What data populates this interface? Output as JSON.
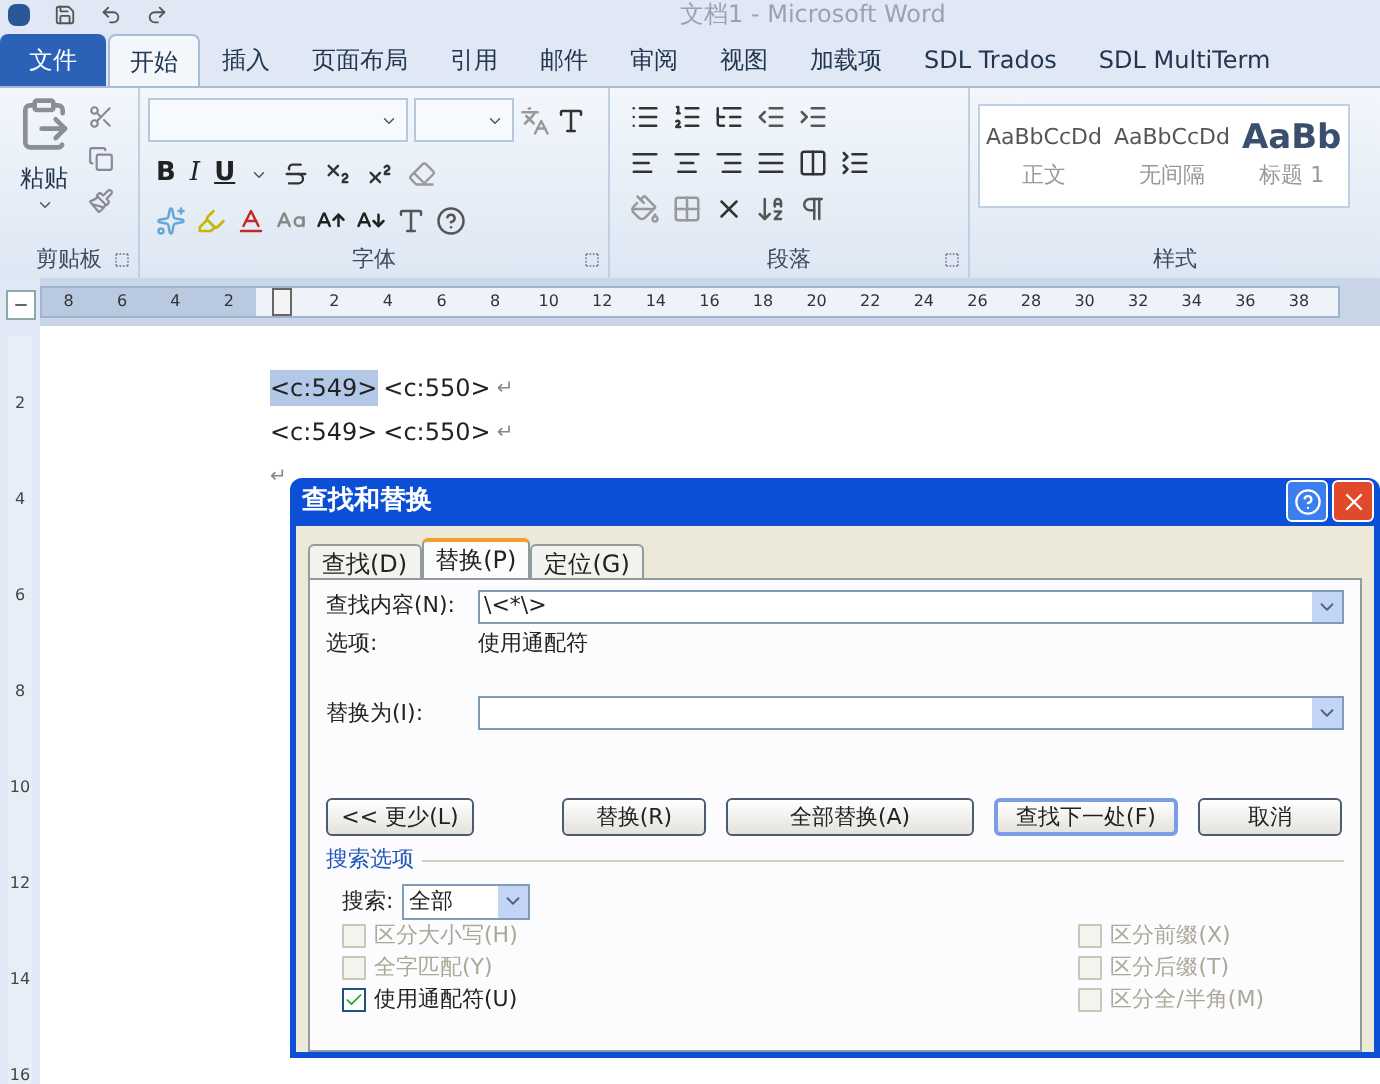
{
  "window": {
    "title": "文档1 - Microsoft Word"
  },
  "ribbon_tabs": [
    {
      "label": "文件",
      "kind": "file",
      "selected": false
    },
    {
      "label": "开始",
      "kind": "tab",
      "selected": true
    },
    {
      "label": "插入",
      "kind": "tab",
      "selected": false
    },
    {
      "label": "页面布局",
      "kind": "tab",
      "selected": false
    },
    {
      "label": "引用",
      "kind": "tab",
      "selected": false
    },
    {
      "label": "邮件",
      "kind": "tab",
      "selected": false
    },
    {
      "label": "审阅",
      "kind": "tab",
      "selected": false
    },
    {
      "label": "视图",
      "kind": "tab",
      "selected": false
    },
    {
      "label": "加载项",
      "kind": "tab",
      "selected": false
    },
    {
      "label": "SDL Trados",
      "kind": "tab",
      "selected": false
    },
    {
      "label": "SDL MultiTerm",
      "kind": "tab",
      "selected": false
    }
  ],
  "clipboard_group": {
    "title": "剪贴板",
    "paste_label": "粘贴"
  },
  "font_group": {
    "title": "字体",
    "bold": "B",
    "italic": "I",
    "underline": "U"
  },
  "paragraph_group": {
    "title": "段落"
  },
  "styles_group": {
    "title": "样式",
    "styles": [
      {
        "sample": "AaBbCcDd",
        "name": "正文",
        "kind": "normal"
      },
      {
        "sample": "AaBbCcDd",
        "name": "无间隔",
        "kind": "normal"
      },
      {
        "sample": "AaBb",
        "name": "标题 1",
        "kind": "heading"
      }
    ]
  },
  "ruler": {
    "left_ticks": [
      "8",
      "6",
      "4",
      "2"
    ],
    "ticks": [
      "2",
      "4",
      "6",
      "8",
      "10",
      "12",
      "14",
      "16",
      "18",
      "20",
      "22",
      "24",
      "26",
      "28",
      "30",
      "32",
      "34",
      "36",
      "38"
    ]
  },
  "vertical_ruler": {
    "ticks": [
      "2",
      "4",
      "6",
      "8",
      "10",
      "12",
      "14",
      "16"
    ]
  },
  "document": {
    "lines": [
      {
        "parts": [
          {
            "text": "<c:549>",
            "selected": true
          },
          {
            "text": "<c:550>",
            "selected": false
          }
        ],
        "mark": "↵"
      },
      {
        "parts": [
          {
            "text": "<c:549>",
            "selected": false
          },
          {
            "text": "<c:550>",
            "selected": false
          }
        ],
        "mark": "↵"
      },
      {
        "mark": "↵"
      }
    ]
  },
  "dialog": {
    "title": "查找和替换",
    "tabs": [
      {
        "label": "查找(D)",
        "selected": false
      },
      {
        "label": "替换(P)",
        "selected": true
      },
      {
        "label": "定位(G)",
        "selected": false
      }
    ],
    "find": {
      "label": "查找内容(N):",
      "value": "\\<*\\>"
    },
    "options": {
      "label": "选项:",
      "value": "使用通配符"
    },
    "replace": {
      "label": "替换为(I):"
    },
    "buttons": [
      {
        "label": "<< 更少(L)",
        "default": false
      },
      {
        "label": "替换(R)",
        "default": false
      },
      {
        "label": "全部替换(A)",
        "default": false
      },
      {
        "label": "查找下一处(F)",
        "default": true
      },
      {
        "label": "取消",
        "default": false
      }
    ],
    "search_options": {
      "title": "搜索选项",
      "search_label": "搜索:",
      "search_value": "全部"
    },
    "checks_left": [
      {
        "label": "区分大小写(H)",
        "checked": false,
        "disabled": true
      },
      {
        "label": "全字匹配(Y)",
        "checked": false,
        "disabled": true
      },
      {
        "label": "使用通配符(U)",
        "checked": true,
        "disabled": false
      }
    ],
    "checks_right": [
      {
        "label": "区分前缀(X)",
        "checked": false,
        "disabled": true
      },
      {
        "label": "区分后缀(T)",
        "checked": false,
        "disabled": true
      },
      {
        "label": "区分全/半角(M)",
        "checked": false,
        "disabled": true
      }
    ]
  }
}
